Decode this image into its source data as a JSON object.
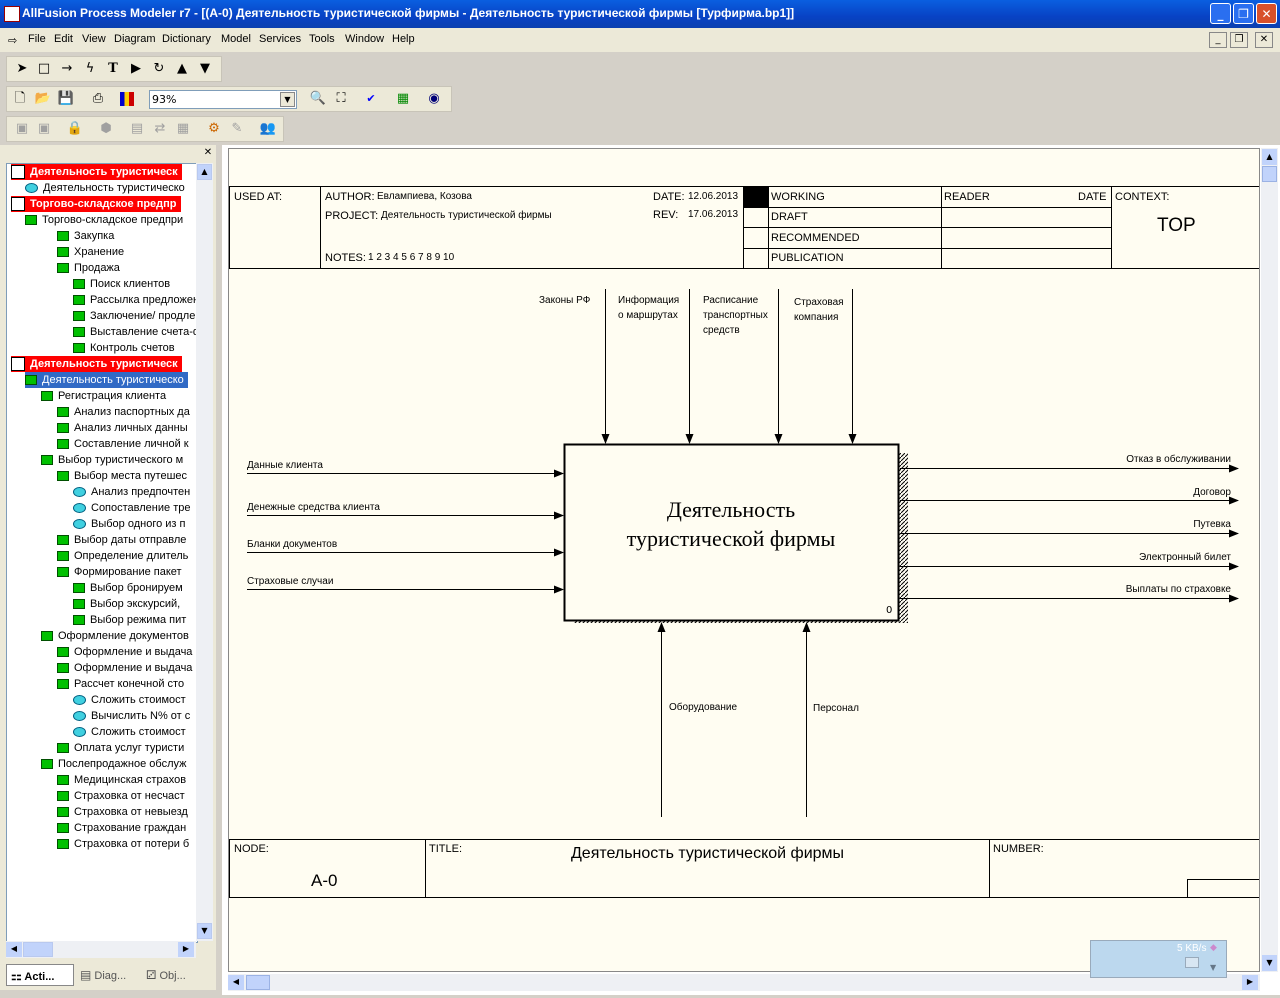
{
  "window": {
    "title": "AllFusion Process Modeler r7 - [(A-0) Деятельность туристической фирмы - Деятельность туристической фирмы  [Турфирма.bp1]]",
    "minimize": "_",
    "maximize": "❐",
    "close": "✕"
  },
  "menu": [
    "File",
    "Edit",
    "View",
    "Diagram",
    "Dictionary",
    "Model",
    "Services",
    "Tools",
    "Window",
    "Help"
  ],
  "zoom": "93%",
  "tree": {
    "items": [
      {
        "label": "Деятельность туристическ",
        "type": "header"
      },
      {
        "label": "Деятельность туристическо",
        "type": "cyan"
      },
      {
        "label": "Торгово-складское предпр",
        "type": "header"
      },
      {
        "label": "Торгово-складское предпри",
        "type": "green"
      },
      {
        "label": "Закупка",
        "type": "green"
      },
      {
        "label": "Хранение",
        "type": "green"
      },
      {
        "label": "Продажа",
        "type": "green"
      },
      {
        "label": "Поиск клиентов",
        "type": "green"
      },
      {
        "label": "Рассылка предложени",
        "type": "green"
      },
      {
        "label": "Заключение/ продлен",
        "type": "green"
      },
      {
        "label": "Выставление счета-ф",
        "type": "green"
      },
      {
        "label": "Контроль счетов",
        "type": "green"
      },
      {
        "label": "Деятельность туристическ",
        "type": "header"
      },
      {
        "label": "Деятельность туристическо",
        "type": "selected"
      },
      {
        "label": "Регистрация клиента",
        "type": "green"
      },
      {
        "label": "Анализ паспортных да",
        "type": "green"
      },
      {
        "label": "Анализ личных данны",
        "type": "green"
      },
      {
        "label": "Составление личной к",
        "type": "green"
      },
      {
        "label": "Выбор туристического м",
        "type": "green"
      },
      {
        "label": "Выбор места путешес",
        "type": "green"
      },
      {
        "label": "Анализ предпочтен",
        "type": "cyan"
      },
      {
        "label": "Сопоставление тре",
        "type": "cyan"
      },
      {
        "label": "Выбор одного из п",
        "type": "cyan"
      },
      {
        "label": "Выбор даты отправле",
        "type": "green"
      },
      {
        "label": "Определение длитель",
        "type": "green"
      },
      {
        "label": "Формирование пакет",
        "type": "green"
      },
      {
        "label": "Выбор бронируем",
        "type": "green"
      },
      {
        "label": "Выбор экскурсий,",
        "type": "green"
      },
      {
        "label": "Выбор режима пит",
        "type": "green"
      },
      {
        "label": "Оформление документов",
        "type": "green"
      },
      {
        "label": "Оформление и выдача",
        "type": "green"
      },
      {
        "label": "Оформление и выдача",
        "type": "green"
      },
      {
        "label": "Рассчет конечной сто",
        "type": "green"
      },
      {
        "label": "Сложить стоимост",
        "type": "cyan"
      },
      {
        "label": "Вычислить N% от с",
        "type": "cyan"
      },
      {
        "label": "Сложить стоимост",
        "type": "cyan"
      },
      {
        "label": "Оплата услуг туристи",
        "type": "green"
      },
      {
        "label": "Послепродажное обслуж",
        "type": "green"
      },
      {
        "label": "Медицинская страхов",
        "type": "green"
      },
      {
        "label": "Страховка от несчаст",
        "type": "green"
      },
      {
        "label": "Страховка от невыезд",
        "type": "green"
      },
      {
        "label": "Страхование граждан",
        "type": "green"
      },
      {
        "label": "Страховка от потери б",
        "type": "green"
      }
    ]
  },
  "tabs": [
    "Acti...",
    "Diag...",
    "Obj..."
  ],
  "diagram": {
    "used_at_label": "USED AT:",
    "author_label": "AUTHOR:",
    "author": "Евлампиева, Козова",
    "project_label": "PROJECT:",
    "project": "Деятельность туристической фирмы",
    "date_label": "DATE:",
    "date": "12.06.2013",
    "rev_label": "REV:",
    "rev": "17.06.2013",
    "notes_label": "NOTES:",
    "notes": "1 2 3 4 5 6 7 8 9 10",
    "status": [
      "WORKING",
      "DRAFT",
      "RECOMMENDED",
      "PUBLICATION"
    ],
    "reader_label": "READER",
    "reader_date_label": "DATE",
    "context_label": "CONTEXT:",
    "context_value": "TOP",
    "box_line1": "Деятельность",
    "box_line2": "туристической фирмы",
    "box_number": "0",
    "controls": [
      {
        "line1": "Законы РФ",
        "line2": "",
        "line3": ""
      },
      {
        "line1": "Информация",
        "line2": "о маршрутах",
        "line3": ""
      },
      {
        "line1": "Расписание",
        "line2": "транспортных",
        "line3": "средств"
      },
      {
        "line1": "Страховая",
        "line2": "компания",
        "line3": ""
      }
    ],
    "inputs": [
      "Данные клиента",
      "Денежные средства клиента",
      "Бланки документов",
      "Страховые случаи"
    ],
    "outputs": [
      "Отказ в обслуживании",
      "Договор",
      "Путевка",
      "Электронный билет",
      "Выплаты по страховке"
    ],
    "mechanisms": [
      "Оборудование",
      "Персонал"
    ],
    "node_label": "NODE:",
    "node_value": "A-0",
    "title_label": "TITLE:",
    "title_value": "Деятельность туристической фирмы",
    "number_label": "NUMBER:"
  },
  "network_widget": "5 KB/s"
}
